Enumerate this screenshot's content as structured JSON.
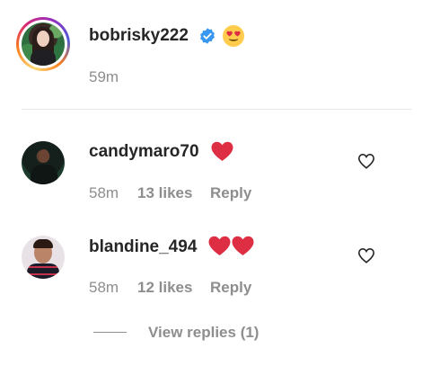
{
  "caption": {
    "username": "bobrisky222",
    "verified_icon": "verified-badge-icon",
    "emoji": "heart-eyes-emoji",
    "time": "59m"
  },
  "comments": [
    {
      "username": "candymaro70",
      "emoji": "red-heart-emoji",
      "time": "58m",
      "likes": "13 likes",
      "reply_label": "Reply"
    },
    {
      "username": "blandine_494",
      "emoji": "two-red-hearts-emoji",
      "time": "58m",
      "likes": "12 likes",
      "reply_label": "Reply"
    }
  ],
  "view_replies": "View replies (1)",
  "colors": {
    "text": "#262626",
    "secondary": "#8e8e8e",
    "verified": "#3897f0",
    "heart": "#dd2e44"
  }
}
